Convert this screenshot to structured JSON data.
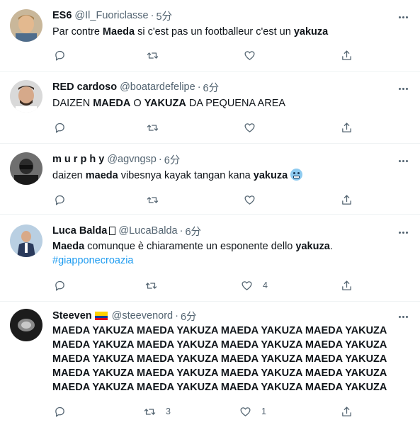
{
  "tweets": [
    {
      "name": "ES6",
      "handle": "@Il_Fuoriclasse",
      "time": "5分",
      "text_parts": [
        "Par contre ",
        "Maeda",
        " si c'est pas un footballeur c'est un ",
        "yakuza"
      ],
      "reply_count": "",
      "retweet_count": "",
      "like_count": ""
    },
    {
      "name": "RED cardoso",
      "handle": "@boatardefelipe",
      "time": "6分",
      "text_parts": [
        "DAIZEN ",
        "MAEDA",
        " O ",
        "YAKUZA",
        " DA PEQUENA AREA"
      ],
      "reply_count": "",
      "retweet_count": "",
      "like_count": ""
    },
    {
      "name": "m u r p h y",
      "handle": "@agvngsp",
      "time": "6分",
      "text_parts": [
        "daizen ",
        "maeda",
        " vibesnya kayak tangan kana ",
        "yakuza"
      ],
      "emoji": "grimacing-face",
      "reply_count": "",
      "retweet_count": "",
      "like_count": ""
    },
    {
      "name": "Luca Balda",
      "handle": "@LucaBalda",
      "time": "6分",
      "text_parts": [
        "Maeda",
        " comunque è chiaramente un esponente dello ",
        "yakuza",
        "."
      ],
      "hashtag": "#giapponecroazia",
      "reply_count": "",
      "retweet_count": "",
      "like_count": "4"
    },
    {
      "name": "Steeven",
      "handle": "@steevenord",
      "time": "6分",
      "flag": "ecuador-flag",
      "text_lines": [
        "MAEDA YAKUZA MAEDA YAKUZA MAEDA YAKUZA MAEDA YAKUZA",
        "MAEDA YAKUZA MAEDA YAKUZA MAEDA YAKUZA MAEDA YAKUZA",
        "MAEDA YAKUZA MAEDA YAKUZA MAEDA YAKUZA MAEDA YAKUZA",
        "MAEDA YAKUZA MAEDA YAKUZA MAEDA YAKUZA MAEDA YAKUZA",
        "MAEDA YAKUZA MAEDA YAKUZA MAEDA YAKUZA MAEDA YAKUZA"
      ],
      "reply_count": "",
      "retweet_count": "3",
      "like_count": "1"
    }
  ],
  "colors": {
    "text": "#0f1419",
    "secondary": "#536471",
    "link": "#1d9bf0",
    "divider": "#eff3f4"
  },
  "icons": [
    "reply-icon",
    "retweet-icon",
    "like-icon",
    "share-icon",
    "more-icon"
  ]
}
